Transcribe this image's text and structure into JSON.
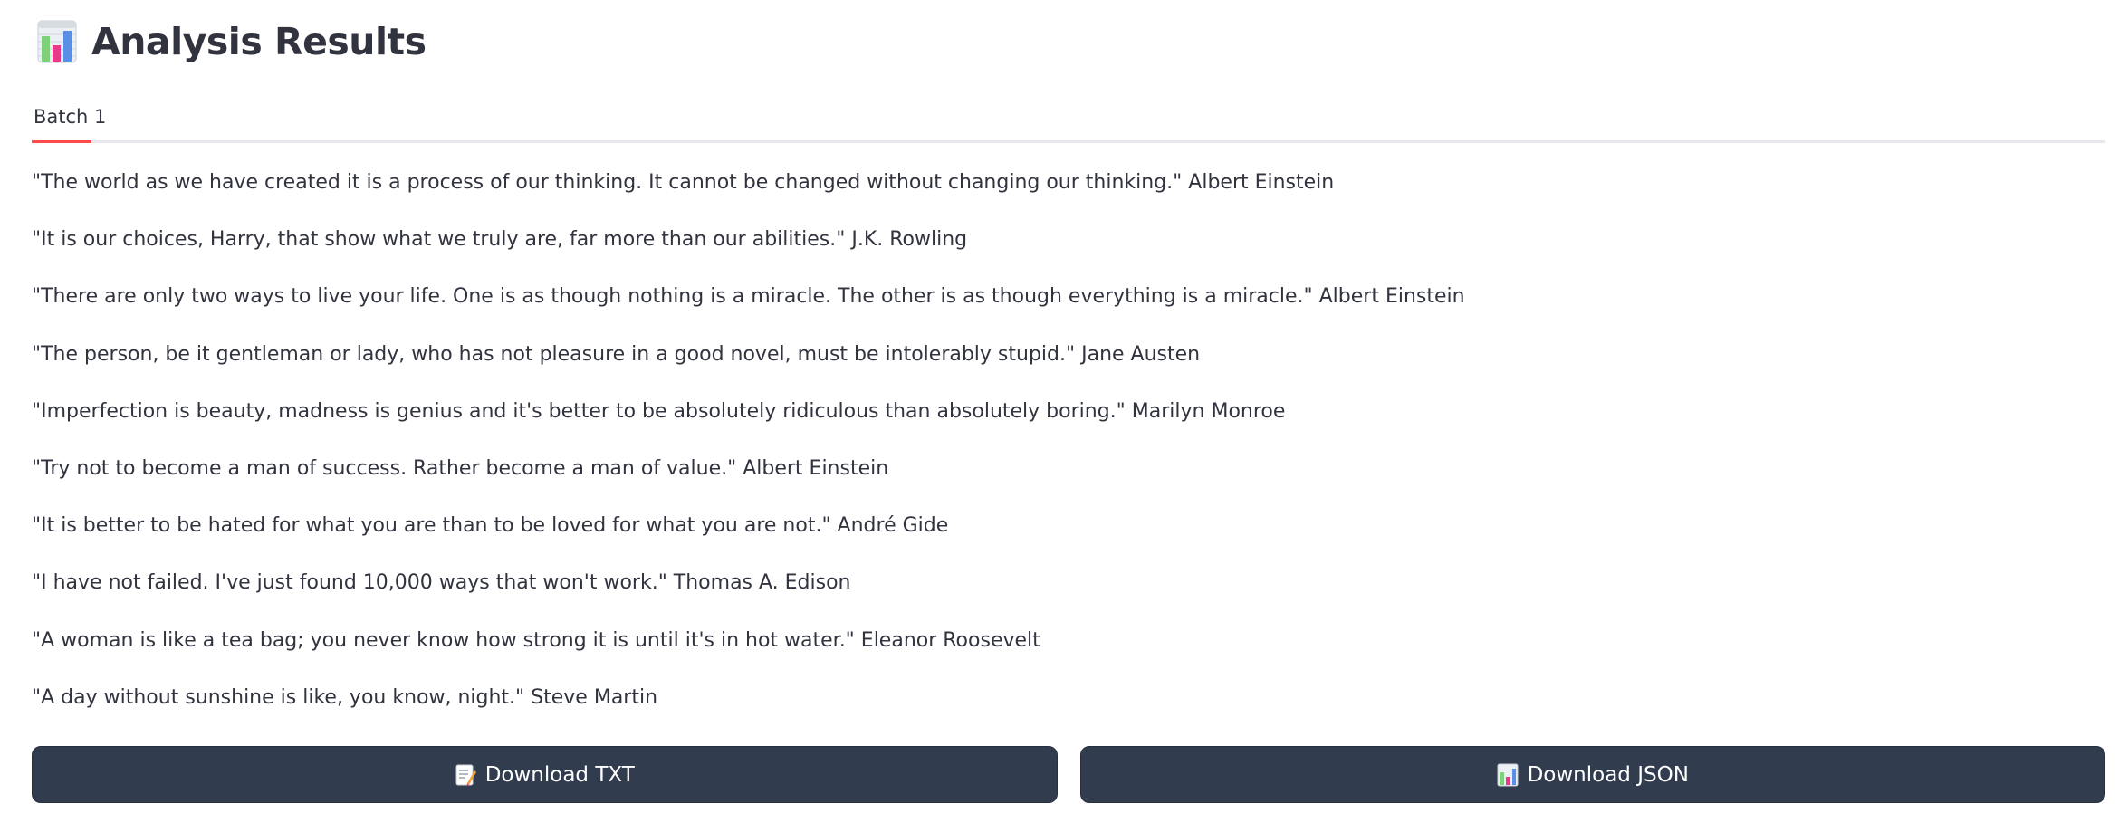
{
  "header": {
    "icon": "bar-chart-icon",
    "title": "Analysis Results"
  },
  "tabs": [
    {
      "label": "Batch 1",
      "active": true
    }
  ],
  "accent_color": "#ff4b4b",
  "quotes": [
    "\"The world as we have created it is a process of our thinking. It cannot be changed without changing our thinking.\" Albert Einstein",
    "\"It is our choices, Harry, that show what we truly are, far more than our abilities.\" J.K. Rowling",
    "\"There are only two ways to live your life. One is as though nothing is a miracle. The other is as though everything is a miracle.\" Albert Einstein",
    "\"The person, be it gentleman or lady, who has not pleasure in a good novel, must be intolerably stupid.\" Jane Austen",
    "\"Imperfection is beauty, madness is genius and it's better to be absolutely ridiculous than absolutely boring.\" Marilyn Monroe",
    "\"Try not to become a man of success. Rather become a man of value.\" Albert Einstein",
    "\"It is better to be hated for what you are than to be loved for what you are not.\" André Gide",
    "\"I have not failed. I've just found 10,000 ways that won't work.\" Thomas A. Edison",
    "\"A woman is like a tea bag; you never know how strong it is until it's in hot water.\" Eleanor Roosevelt",
    "\"A day without sunshine is like, you know, night.\" Steve Martin"
  ],
  "buttons": {
    "download_txt": {
      "icon": "memo-icon",
      "label": "Download TXT"
    },
    "download_json": {
      "icon": "bar-chart-icon",
      "label": "Download JSON"
    }
  },
  "button_color": "#313c4e"
}
